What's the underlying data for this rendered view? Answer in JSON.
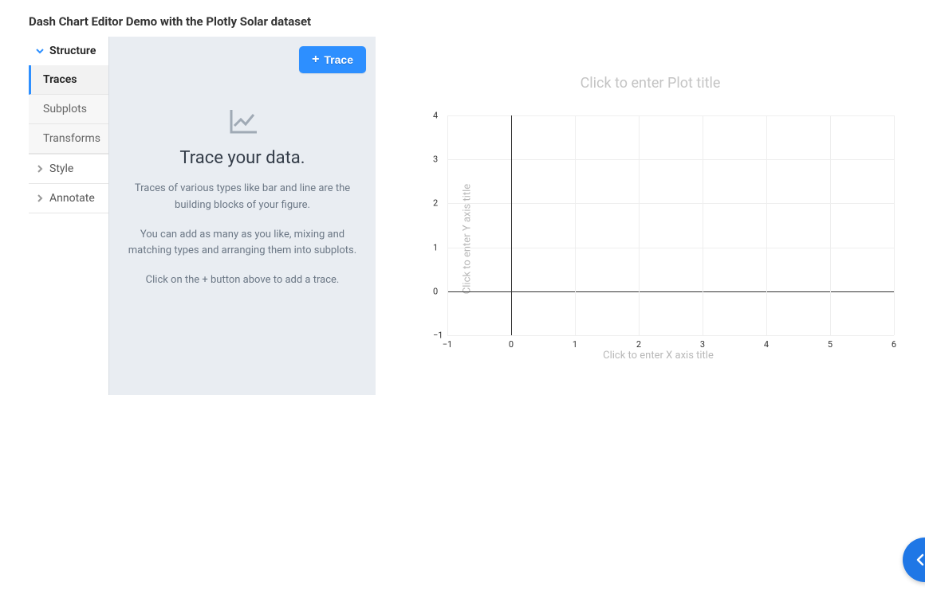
{
  "page_title": "Dash Chart Editor Demo with the Plotly Solar dataset",
  "sidebar": {
    "sections": [
      {
        "label": "Structure",
        "expanded": true,
        "items": [
          {
            "label": "Traces",
            "active": true
          },
          {
            "label": "Subplots",
            "active": false
          },
          {
            "label": "Transforms",
            "active": false
          }
        ]
      },
      {
        "label": "Style",
        "expanded": false,
        "items": []
      },
      {
        "label": "Annotate",
        "expanded": false,
        "items": []
      }
    ]
  },
  "panel": {
    "add_trace_label": "Trace",
    "empty_title": "Trace your data.",
    "empty_p1": "Traces of various types like bar and line are the building blocks of your figure.",
    "empty_p2": "You can add as many as you like, mixing and matching types and arranging them into subplots.",
    "empty_p3": "Click on the + button above to add a trace."
  },
  "chart": {
    "title_placeholder": "Click to enter Plot title",
    "x_title_placeholder": "Click to enter X axis title",
    "y_title_placeholder": "Click to enter Y axis title"
  },
  "chart_data": {
    "type": "scatter",
    "series": [],
    "x_ticks": [
      "−1",
      "0",
      "1",
      "2",
      "3",
      "4",
      "5",
      "6"
    ],
    "y_ticks": [
      "−1",
      "0",
      "1",
      "2",
      "3",
      "4"
    ],
    "xlim": [
      -1,
      6
    ],
    "ylim": [
      -1,
      4
    ],
    "x_zero_index": 1,
    "y_zero_index": 1,
    "title": "",
    "xlabel": "",
    "ylabel": ""
  }
}
